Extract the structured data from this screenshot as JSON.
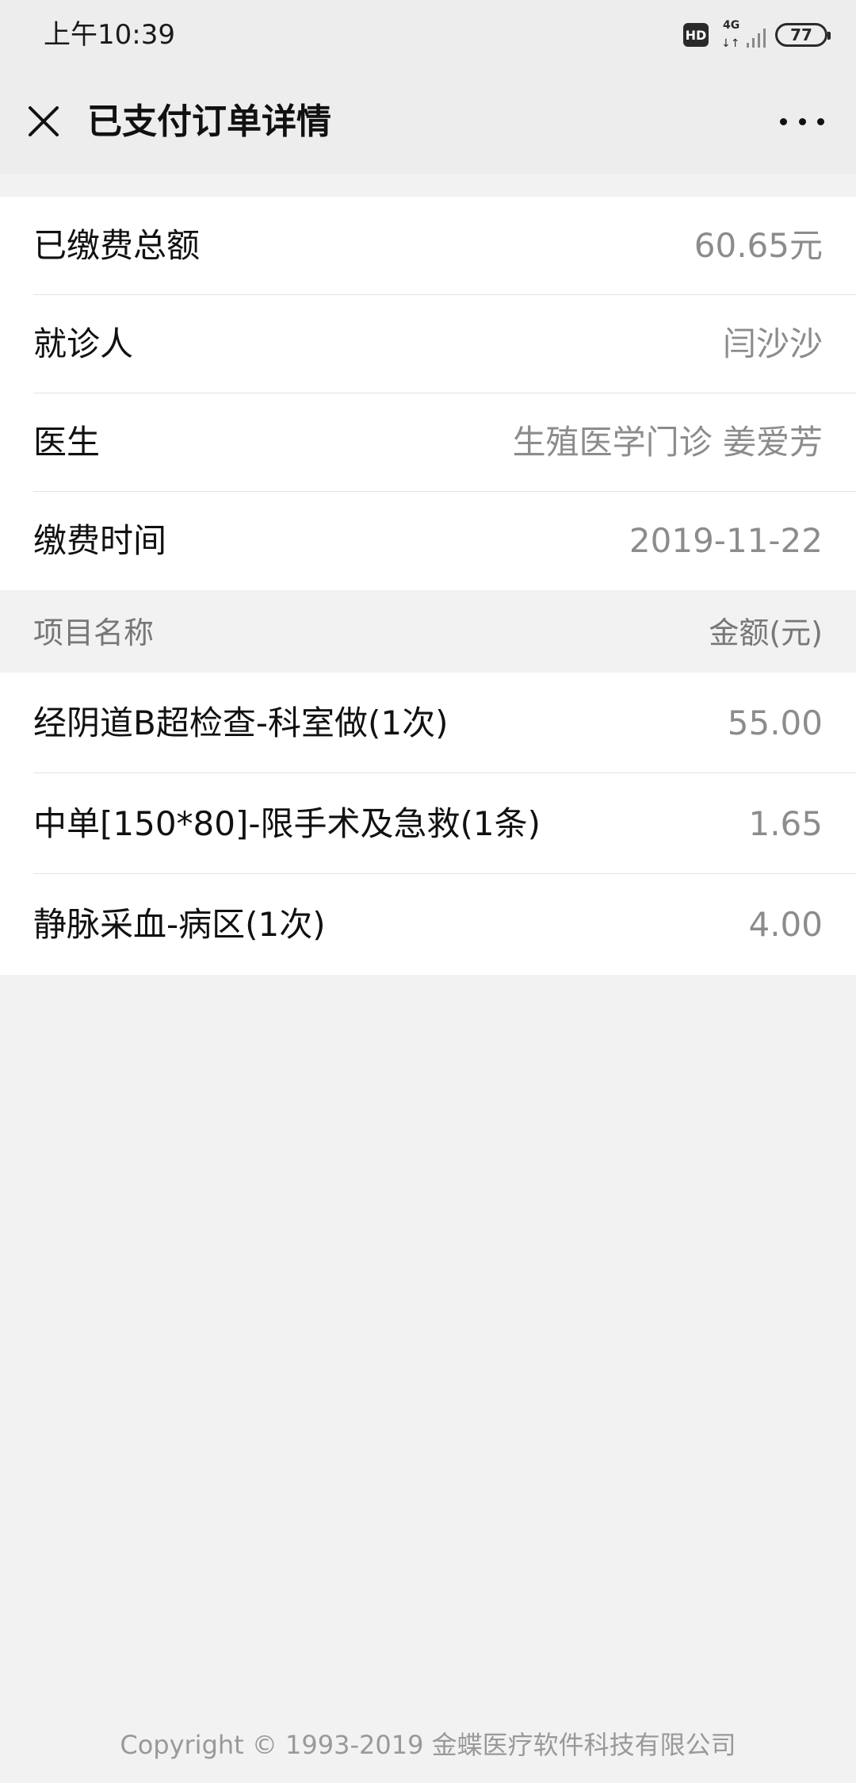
{
  "status_bar": {
    "time": "上午10:39",
    "hd_badge": "HD",
    "network": "4G",
    "network_arrows": "↓↑",
    "battery": "77"
  },
  "nav": {
    "title": "已支付订单详情",
    "close_icon": "close-icon",
    "more_icon": "more-icon"
  },
  "info": [
    {
      "label": "已缴费总额",
      "value": "60.65元"
    },
    {
      "label": "就诊人",
      "value": "闫沙沙"
    },
    {
      "label": "医生",
      "value": "生殖医学门诊 姜爱芳"
    },
    {
      "label": "缴费时间",
      "value": "2019-11-22"
    }
  ],
  "items_header": {
    "name": "项目名称",
    "amount": "金额(元)"
  },
  "items": [
    {
      "name": "经阴道B超检查-科室做(1次)",
      "amount": "55.00"
    },
    {
      "name": "中单[150*80]-限手术及急救(1条)",
      "amount": "1.65"
    },
    {
      "name": "静脉采血-病区(1次)",
      "amount": "4.00"
    }
  ],
  "footer": {
    "copyright": "Copyright © 1993-2019 金蝶医疗软件科技有限公司"
  }
}
